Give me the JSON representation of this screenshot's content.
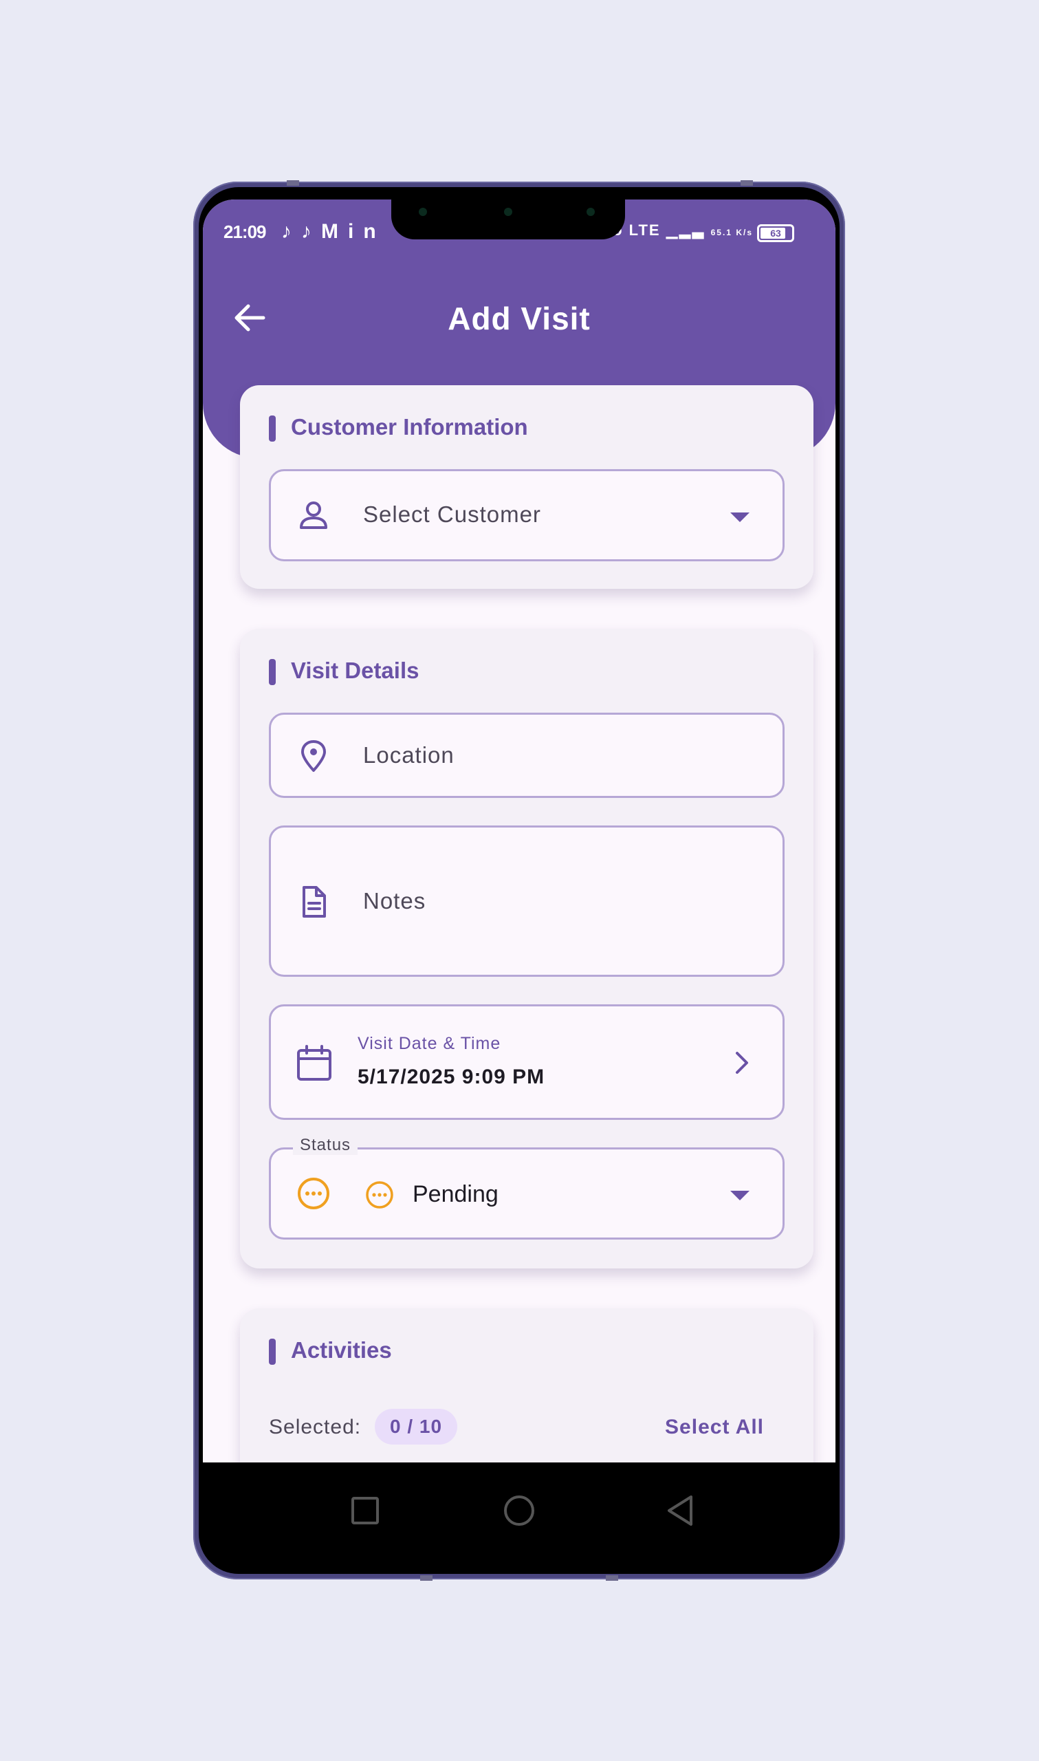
{
  "status_bar": {
    "time": "21:09",
    "left_icons": [
      "tiktok-icon",
      "tiktok-icon",
      "gmail-icon",
      "linkedin-icon"
    ],
    "right_text": "Vo LTE",
    "speed": "65.1 K/s",
    "battery": "63"
  },
  "appbar": {
    "title": "Add Visit",
    "back_icon": "arrow-left-icon"
  },
  "customer_card": {
    "title": "Customer Information",
    "customer_select": {
      "placeholder": "Select Customer",
      "icon": "person-icon"
    }
  },
  "visit_card": {
    "title": "Visit Details",
    "location": {
      "placeholder": "Location",
      "icon": "location-pin-icon"
    },
    "notes": {
      "placeholder": "Notes",
      "icon": "document-icon"
    },
    "datetime": {
      "label": "Visit Date & Time",
      "value": "5/17/2025 9:09 PM",
      "icon": "calendar-icon"
    },
    "status": {
      "legend": "Status",
      "value": "Pending",
      "icon": "pending-icon"
    }
  },
  "activities_card": {
    "title": "Activities",
    "selected_label": "Selected:",
    "selected_count": "0 / 10",
    "select_all": "Select All"
  },
  "colors": {
    "primary": "#6a52a6",
    "pending": "#f0a020",
    "background": "#fcf7fd",
    "card": "#f4f0f7",
    "border": "#b6a7d6"
  }
}
